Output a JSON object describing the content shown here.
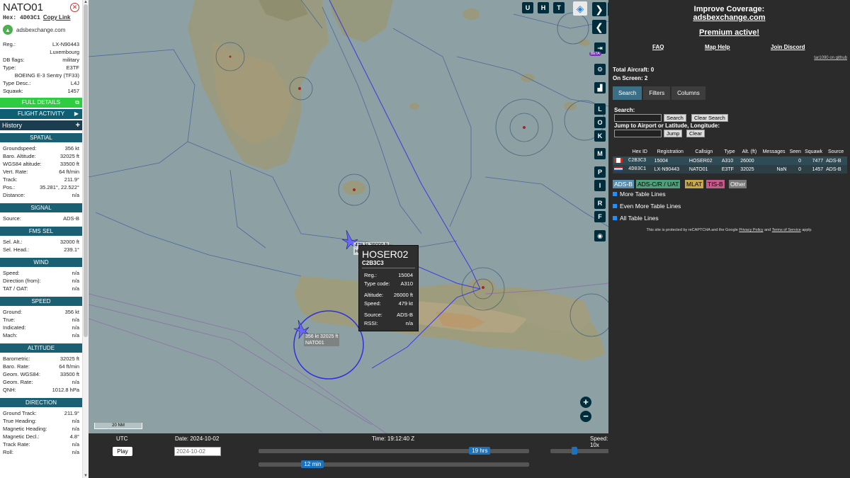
{
  "left": {
    "callsign": "NATO01",
    "hex_label": "Hex:",
    "hex": "4D03C1",
    "copy_link": "Copy Link",
    "site": "adsbexchange.com",
    "info": [
      {
        "k": "Reg.:",
        "v": "LX-N90443"
      },
      {
        "k": "",
        "v": "Luxembourg"
      },
      {
        "k": "DB flags:",
        "v": "military"
      },
      {
        "k": "Type:",
        "v": "E3TF"
      },
      {
        "k": "",
        "v": "BOEING E-3 Sentry (TF33)"
      },
      {
        "k": "Type Desc.:",
        "v": "L4J"
      },
      {
        "k": "Squawk:",
        "v": "1457"
      }
    ],
    "full_details": "FULL DETAILS",
    "flight_activity": "FLIGHT ACTIVITY",
    "history": "History",
    "sections": [
      {
        "title": "SPATIAL",
        "rows": [
          {
            "k": "Groundspeed:",
            "v": "356 kt"
          },
          {
            "k": "Baro. Altitude:",
            "v": "32025 ft"
          },
          {
            "k": "WGS84 altitude:",
            "v": "33500 ft"
          },
          {
            "k": "Vert. Rate:",
            "v": "64 ft/min"
          },
          {
            "k": "Track:",
            "v": "211.9°"
          },
          {
            "k": "Pos.:",
            "v": "35.281°, 22.522°"
          },
          {
            "k": "Distance:",
            "v": "n/a"
          }
        ]
      },
      {
        "title": "SIGNAL",
        "rows": [
          {
            "k": "Source:",
            "v": "ADS-B"
          }
        ]
      },
      {
        "title": "FMS SEL",
        "rows": [
          {
            "k": "Sel. Alt.:",
            "v": "32000 ft"
          },
          {
            "k": "Sel. Head.:",
            "v": "239.1°"
          }
        ]
      },
      {
        "title": "WIND",
        "rows": [
          {
            "k": "Speed:",
            "v": "n/a"
          },
          {
            "k": "Direction (from):",
            "v": "n/a"
          },
          {
            "k": "TAT / OAT:",
            "v": "n/a"
          }
        ]
      },
      {
        "title": "SPEED",
        "rows": [
          {
            "k": "Ground:",
            "v": "356 kt"
          },
          {
            "k": "True:",
            "v": "n/a"
          },
          {
            "k": "Indicated:",
            "v": "n/a"
          },
          {
            "k": "Mach:",
            "v": "n/a"
          }
        ]
      },
      {
        "title": "ALTITUDE",
        "rows": [
          {
            "k": "Barometric:",
            "v": "32025 ft"
          },
          {
            "k": "Baro. Rate:",
            "v": "64 ft/min"
          },
          {
            "k": "Geom. WGS84:",
            "v": "33500 ft"
          },
          {
            "k": "Geom. Rate:",
            "v": "n/a"
          },
          {
            "k": "QNH:",
            "v": "1012.8 hPa"
          }
        ]
      },
      {
        "title": "DIRECTION",
        "rows": [
          {
            "k": "Ground Track:",
            "v": "211.9°"
          },
          {
            "k": "True Heading:",
            "v": "n/a"
          },
          {
            "k": "Magnetic Heading:",
            "v": "n/a"
          },
          {
            "k": "Magnetic Decl.:",
            "v": "4.8°"
          },
          {
            "k": "Track Rate:",
            "v": "n/a"
          },
          {
            "k": "Roll:",
            "v": "n/a"
          }
        ]
      }
    ]
  },
  "map": {
    "top_buttons": [
      "U",
      "H",
      "T"
    ],
    "side_buttons": [
      "L",
      "O",
      "K",
      "M",
      "P",
      "I",
      "R",
      "F"
    ],
    "beta": "BETA",
    "scale": "20 NM",
    "zoom_in": "+",
    "zoom_out": "−",
    "label_hoser": "479 kt  26000 ft",
    "label_hoser_cs": "H",
    "label_nato_1": "356 kt  32025 ft",
    "label_nato_2": "NATO01",
    "popup": {
      "callsign": "HOSER02",
      "hex": "C2B3C3",
      "rows1": [
        {
          "k": "Reg.:",
          "v": "15004"
        },
        {
          "k": "Type code:",
          "v": "A310"
        }
      ],
      "rows2": [
        {
          "k": "Altitude:",
          "v": "26000 ft"
        },
        {
          "k": "Speed:",
          "v": "479 kt"
        }
      ],
      "rows3": [
        {
          "k": "Source:",
          "v": "ADS-B"
        },
        {
          "k": "RSSI:",
          "v": "n/a"
        }
      ]
    }
  },
  "bottom": {
    "utc": "UTC",
    "date": "Date: 2024-10-02",
    "time": "Time: 19:12:40 Z",
    "speed": "Speed: 10x",
    "play": "Play",
    "date_placeholder": "2024-10-02",
    "slider1_label": "19 hrs",
    "slider1_value": 0.82,
    "slider2_label": "12 min",
    "slider2_value": 0.2,
    "speed_value": 0.22
  },
  "right": {
    "improve": "Improve Coverage:",
    "site": "adsbexchange.com",
    "premium": "Premium active!",
    "links": [
      "FAQ",
      "Map Help",
      "Join Discord"
    ],
    "github": "tar1090 on github",
    "total": "Total Aircraft: 0",
    "onscreen": "On Screen: 2",
    "tabs": [
      "Search",
      "Filters",
      "Columns"
    ],
    "search_label": "Search:",
    "search_btn": "Search",
    "clear_search_btn": "Clear Search",
    "jump_label": "Jump to Airport or Latitude, Longitude:",
    "jump_btn": "Jump",
    "clear_btn": "Clear",
    "columns": [
      "",
      "Hex ID",
      "Registration",
      "Callsign",
      "Type",
      "Alt. (ft)",
      "Messages",
      "Seen",
      "Squawk",
      "Source"
    ],
    "rows": [
      {
        "flag": "ca",
        "hex": "C2B3C3",
        "reg": "15004",
        "cs": "HOSER02",
        "type": "A310",
        "alt": "26000",
        "msg": "",
        "seen": "0",
        "sq": "7477",
        "src": "ADS-B"
      },
      {
        "flag": "nl",
        "hex": "4D03C1",
        "reg": "LX-N90443",
        "cs": "NATO01",
        "type": "E3TF",
        "alt": "32025",
        "msg": "NaN",
        "seen": "0",
        "sq": "1457",
        "src": "ADS-B"
      }
    ],
    "sources": [
      {
        "label": "ADS-B",
        "color": "#5b8fb0"
      },
      {
        "label": "ADS-C/R / UAT",
        "color": "#4fa07a"
      },
      {
        "label": "MLAT",
        "color": "#c7a84a"
      },
      {
        "label": "TIS-B",
        "color": "#c45b8a"
      },
      {
        "label": "Other",
        "color": "#7a7a7a"
      }
    ],
    "more_lines": "More Table Lines",
    "even_more": "Even More Table Lines",
    "all_lines": "All Table Lines",
    "recaptcha": "This site is protected by reCAPTCHA and the Google",
    "privacy": "Privacy Policy",
    "and": "and",
    "terms": "Terms of Service",
    "apply": "apply."
  }
}
